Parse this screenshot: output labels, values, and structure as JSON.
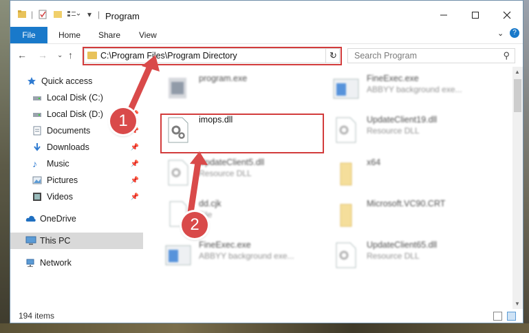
{
  "window": {
    "title": "Program",
    "controls": [
      "minimize",
      "maximize",
      "close"
    ]
  },
  "ribbon": {
    "tabs": [
      "File",
      "Home",
      "Share",
      "View"
    ]
  },
  "address_bar": {
    "path": "C:\\Program Files\\Program Directory"
  },
  "search": {
    "placeholder": "Search Program"
  },
  "nav_pane": {
    "items": [
      {
        "label": "Quick access",
        "icon": "star-icon",
        "pinned": false
      },
      {
        "label": "Local Disk (C:)",
        "icon": "drive-icon",
        "pinned": false
      },
      {
        "label": "Local Disk (D:)",
        "icon": "drive-icon",
        "pinned": true
      },
      {
        "label": "Documents",
        "icon": "documents-icon",
        "pinned": true
      },
      {
        "label": "Downloads",
        "icon": "downloads-icon",
        "pinned": true
      },
      {
        "label": "Music",
        "icon": "music-icon",
        "pinned": true
      },
      {
        "label": "Pictures",
        "icon": "pictures-icon",
        "pinned": true
      },
      {
        "label": "Videos",
        "icon": "videos-icon",
        "pinned": true
      },
      {
        "label": "OneDrive",
        "icon": "cloud-icon",
        "pinned": false
      },
      {
        "label": "This PC",
        "icon": "computer-icon",
        "pinned": false,
        "selected": true
      },
      {
        "label": "Network",
        "icon": "network-icon",
        "pinned": false
      }
    ]
  },
  "files": [
    {
      "name": "program.exe",
      "sub": "",
      "icon": "program-icon",
      "focus": false
    },
    {
      "name": "FineExec.exe",
      "sub": "ABBYY background exe...",
      "icon": "exe-icon",
      "focus": false
    },
    {
      "name": "imops.dll",
      "sub": "",
      "icon": "dll-gear-icon",
      "focus": true
    },
    {
      "name": "UpdateClient19.dll",
      "sub": "Resource DLL",
      "icon": "dll-gear-icon",
      "focus": false
    },
    {
      "name": "UpdateClient5.dll",
      "sub": "Resource DLL",
      "icon": "dll-gear-icon",
      "focus": false
    },
    {
      "name": "x64",
      "sub": "",
      "icon": "folder-icon",
      "focus": false
    },
    {
      "name": "dd.cjk",
      "sub": "File",
      "icon": "file-icon",
      "focus": false
    },
    {
      "name": "Microsoft.VC90.CRT",
      "sub": "",
      "icon": "folder-icon",
      "focus": false
    },
    {
      "name": "FineExec.exe",
      "sub": "ABBYY background exe...",
      "icon": "exe-icon",
      "focus": false
    },
    {
      "name": "UpdateClient65.dll",
      "sub": "Resource DLL",
      "icon": "dll-gear-icon",
      "focus": false
    }
  ],
  "status": {
    "items_count": "194 items"
  },
  "annotations": {
    "step1": "1",
    "step2": "2"
  },
  "colors": {
    "accent": "#1979ca",
    "highlight_box": "#d23b3b",
    "callout": "#d94a4a",
    "selection": "#d9d9d9"
  }
}
